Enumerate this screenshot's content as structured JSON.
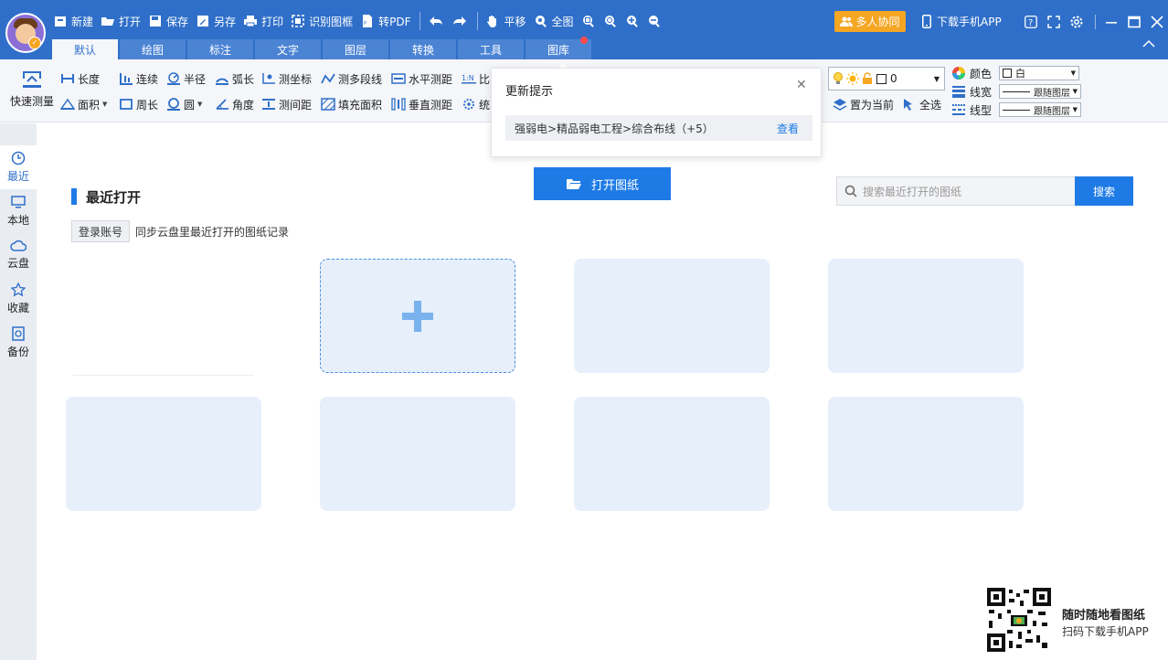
{
  "toolbar": {
    "new": "新建",
    "open": "打开",
    "save": "保存",
    "save_as": "另存",
    "print": "打印",
    "detect_frame": "识别图框",
    "to_pdf": "转PDF",
    "pan": "平移",
    "fit_all": "全图",
    "collab": "多人协同",
    "download_app": "下载手机APP"
  },
  "tabs": [
    {
      "label": "默认",
      "active": true
    },
    {
      "label": "绘图"
    },
    {
      "label": "标注"
    },
    {
      "label": "文字"
    },
    {
      "label": "图层"
    },
    {
      "label": "转换"
    },
    {
      "label": "工具"
    },
    {
      "label": "图库",
      "badge_dot": true
    }
  ],
  "ribbon": {
    "quick_measure": "快速测量",
    "row1": [
      "长度",
      "连续",
      "半径",
      "弧长",
      "测坐标",
      "测多段线",
      "水平测距",
      "比"
    ],
    "row2": [
      "面积",
      "周长",
      "圆",
      "角度",
      "测间距",
      "填充面积",
      "垂直测距",
      "统"
    ],
    "set_current": "置为当前",
    "select_all": "全选",
    "layer_value": "0",
    "color_label": "颜色",
    "color_value": "白",
    "linewidth_label": "线宽",
    "linewidth_value": "跟随图层",
    "linetype_label": "线型",
    "linetype_value": "跟随图层"
  },
  "sidebar": [
    {
      "label": "最近",
      "icon": "clock-icon",
      "active": true
    },
    {
      "label": "本地",
      "icon": "monitor-icon"
    },
    {
      "label": "云盘",
      "icon": "cloud-icon"
    },
    {
      "label": "收藏",
      "icon": "star-icon"
    },
    {
      "label": "备份",
      "icon": "backup-icon"
    }
  ],
  "main": {
    "section_title": "最近打开",
    "login_button": "登录账号",
    "sync_hint": "同步云盘里最近打开的图纸记录",
    "open_drawing": "打开图纸",
    "search_placeholder": "搜索最近打开的图纸",
    "search_button": "搜索"
  },
  "popup": {
    "title": "更新提示",
    "item_text": "强弱电>精品弱电工程>综合布线（+5）",
    "view_link": "查看"
  },
  "promo": {
    "title": "随时随地看图纸",
    "subtitle": "扫码下载手机APP"
  },
  "colors": {
    "titlebar": "#2f6fc9",
    "accent": "#1e7be6",
    "collab": "#f5a623",
    "card": "#e6effa"
  }
}
